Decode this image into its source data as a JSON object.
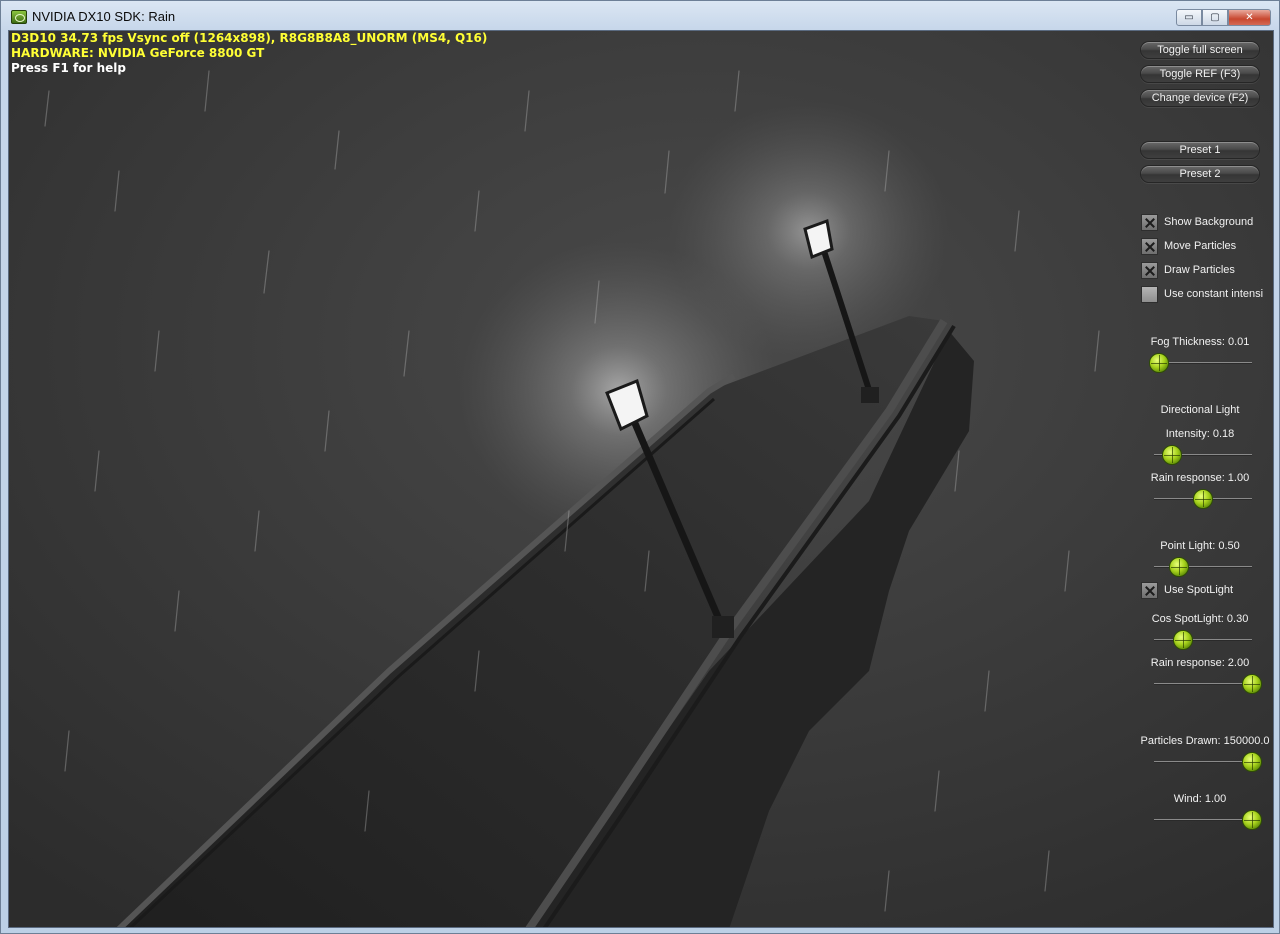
{
  "window": {
    "title": "NVIDIA DX10 SDK: Rain",
    "minimize_glyph": "▭",
    "maximize_glyph": "▢",
    "close_glyph": "✕"
  },
  "hud": {
    "stats_line": "D3D10 34.73 fps Vsync off (1264x898), R8G8B8A8_UNORM (MS4, Q16)",
    "hardware_line": "HARDWARE: NVIDIA GeForce 8800 GT",
    "help_line": "Press F1 for help",
    "stats_color": "#ffff35",
    "help_color": "#ffffff"
  },
  "buttons": {
    "toggle_full_screen": "Toggle full screen",
    "toggle_ref": "Toggle REF (F3)",
    "change_device": "Change device (F2)",
    "preset_1": "Preset 1",
    "preset_2": "Preset 2"
  },
  "checkboxes": {
    "show_background": {
      "label": "Show Background",
      "checked": true
    },
    "move_particles": {
      "label": "Move Particles",
      "checked": true
    },
    "draw_particles": {
      "label": "Draw Particles",
      "checked": true
    },
    "use_constant_intensity": {
      "label": "Use constant intensi",
      "checked": false
    },
    "use_spotlight": {
      "label": "Use SpotLight",
      "checked": true
    }
  },
  "sliders": {
    "fog_thickness": {
      "label": "Fog Thickness: 0.01",
      "position": 0.05
    },
    "directional_light_heading": "Directional Light",
    "dir_intensity": {
      "label": "Intensity: 0.18",
      "position": 0.18
    },
    "dir_rain_response": {
      "label": "Rain response: 1.00",
      "position": 0.5
    },
    "point_light": {
      "label": "Point Light: 0.50",
      "position": 0.25
    },
    "cos_spotlight": {
      "label": "Cos SpotLight: 0.30",
      "position": 0.3
    },
    "spot_rain_response": {
      "label": "Rain response: 2.00",
      "position": 1.0
    },
    "particles_drawn": {
      "label": "Particles Drawn: 150000.0",
      "position": 1.0
    },
    "wind": {
      "label": "Wind: 1.00",
      "position": 1.0
    }
  },
  "accent_color": "#a7d21c"
}
